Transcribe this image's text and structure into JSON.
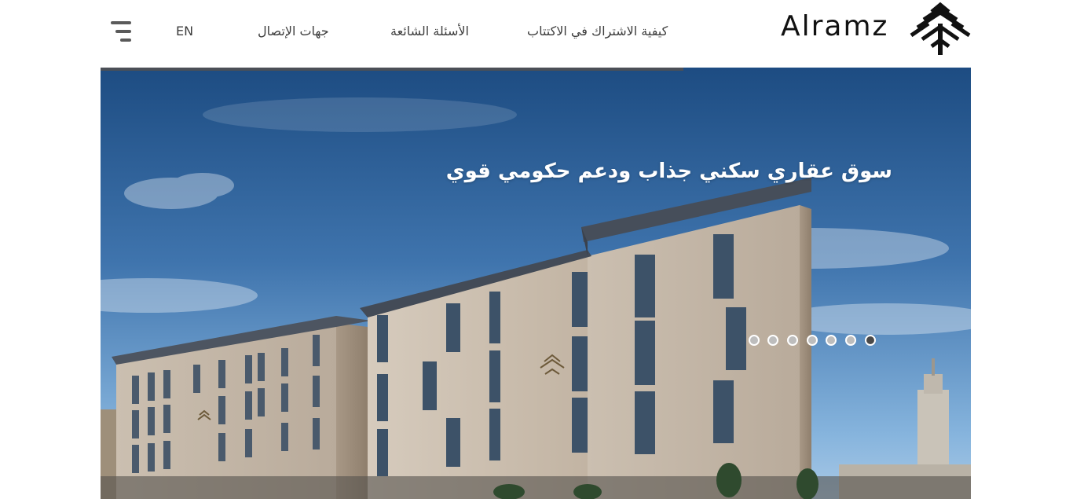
{
  "header": {
    "logo_text": "Alramz",
    "nav": {
      "language": "EN",
      "contact": "جهات الإتصال",
      "faq": "الأسئلة الشائعة",
      "how_to_subscribe": "كيفية الاشتراك في الاكتتاب"
    },
    "menu_icon": "menu-icon"
  },
  "hero": {
    "headline": "سوق عقاري سكني جذاب ودعم حكومي قوي",
    "progress_fraction": 0.67,
    "slides_count": 7,
    "active_slide_index": 6
  },
  "colors": {
    "sky_top": "#1f4f86",
    "sky_bottom": "#7fb1d9",
    "text_dark": "#3c3c3c",
    "dot_inactive": "#bdbdbd",
    "dot_active": "#4a4a4a"
  }
}
